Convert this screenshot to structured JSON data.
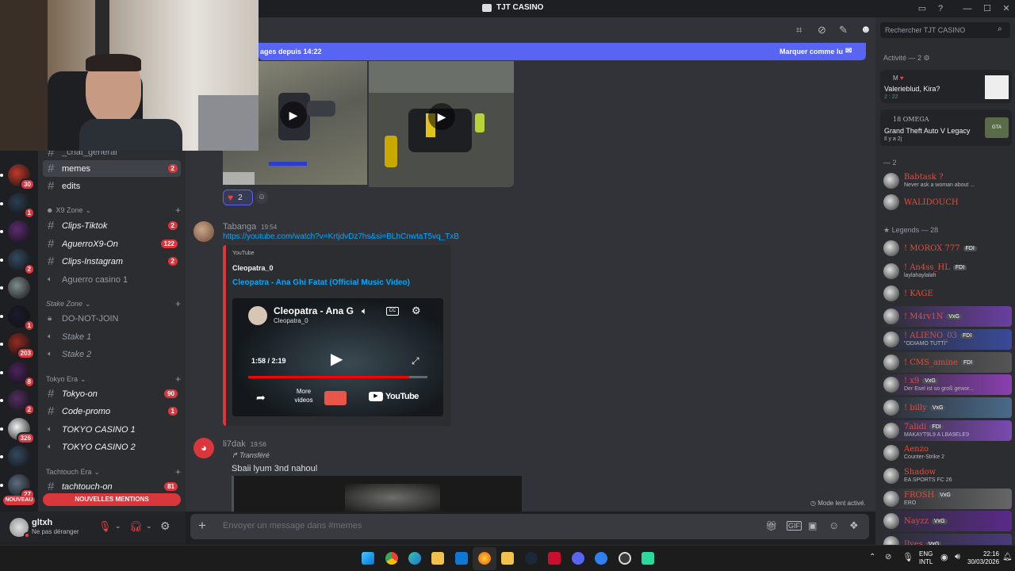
{
  "window": {
    "title": "TJT CASINO"
  },
  "search": {
    "placeholder": "Rechercher TJT CASINO"
  },
  "banner": {
    "text": "ages depuis 14:22",
    "mark_read": "Marquer comme lu"
  },
  "guilds": [
    {
      "badge": "30"
    },
    {
      "badge": "1"
    },
    {
      "badge": ""
    },
    {
      "badge": "2"
    },
    {
      "badge": ""
    },
    {
      "badge": "1"
    },
    {
      "badge": "203"
    },
    {
      "badge": "8"
    },
    {
      "badge": "2"
    },
    {
      "badge": "326"
    },
    {
      "badge": ""
    },
    {
      "badge": "27"
    }
  ],
  "guild_new_label": "NOUVEAU",
  "channels": {
    "partial_top": "_chat_general",
    "memes": {
      "name": "memes",
      "count": "2"
    },
    "edits": {
      "name": "edits"
    },
    "cat_x9": "X9 Zone",
    "clips_tiktok": {
      "name": "Clips-Tiktok",
      "count": "2"
    },
    "aguerro_on": {
      "name": "AguerroX9-On",
      "count": "122"
    },
    "clips_insta": {
      "name": "Clips-Instagram",
      "count": "2"
    },
    "aguerro_casino": {
      "name": "Aguerro casino 1"
    },
    "cat_stake": "Stake Zone",
    "do_not_join": {
      "name": "DO-NOT-JOIN"
    },
    "stake1": {
      "name": "Stake 1"
    },
    "stake2": {
      "name": "Stake 2"
    },
    "cat_tokyo": "Tokyo Era",
    "tokyo_on": {
      "name": "Tokyo-on",
      "count": "90"
    },
    "code_promo": {
      "name": "Code-promo",
      "count": "1"
    },
    "tokyo_casino1": {
      "name": "TOKYO CASINO 1"
    },
    "tokyo_casino2": {
      "name": "TOKYO CASINO 2"
    },
    "cat_tachtouch": "Tachtouch Era",
    "tachtouch_on": {
      "name": "tachtouch-on",
      "count": "81"
    },
    "new_mentions": "NOUVELLES MENTIONS"
  },
  "user": {
    "name": "gltxh",
    "status": "Ne pas déranger"
  },
  "messages": {
    "reaction_count": "2",
    "m1": {
      "author": "Tabanga",
      "time": "19:54",
      "link": "https://youtube.com/watch?v=KrtjdvDz7hs&si=BLhCnwtaT5vq_TxB",
      "provider": "YouTube",
      "channel": "Cleopatra_0",
      "title": "Cleopatra - Ana Ghi Fatat (Official Music Video)",
      "video_title": "Cleopatra - Ana G",
      "video_channel": "Cleopatra_0",
      "timecode": "1:58 / 2:19",
      "more_videos": "More videos",
      "youtube": "YouTube",
      "progress": 0.9
    },
    "m2": {
      "author": "li7dak",
      "time": "19:56",
      "forwarded": "Transféré",
      "text": "Sbaii lyum 3nd nahoul"
    }
  },
  "slowmode": "Mode lent activé.",
  "composer": {
    "placeholder": "Envoyer un message dans #memes"
  },
  "members": {
    "activity_header": "Activité — 2",
    "activity": [
      {
        "name_prefix": "M",
        "title": "Valerieblud, Kira?",
        "sub": "2 : 22"
      },
      {
        "name_prefix": "18 OMEGA",
        "title": "Grand Theft Auto V Legacy",
        "sub": "Il y a 2j"
      }
    ],
    "group2_header": "— 2",
    "group2": [
      {
        "name": "Babtask ?",
        "status": "Never ask a woman about ..."
      },
      {
        "name": "WALIDOUCH",
        "status": ""
      }
    ],
    "legends_header": "Legends — 28",
    "legends": [
      {
        "name": "! MOROX 777",
        "badge": "FDI",
        "status": ""
      },
      {
        "name": "! An4ss_HL",
        "badge": "FDI",
        "status": "laylahaylalah"
      },
      {
        "name": "! KAGE",
        "badge": "",
        "status": ""
      },
      {
        "name": "! M4rv1N",
        "badge": "VxG",
        "status": ""
      },
      {
        "name": "! ALIENO_03",
        "badge": "FDI",
        "status": "\"ODIAMO TUTTI\""
      },
      {
        "name": "! CMS_amine",
        "badge": "FDI",
        "status": ""
      },
      {
        "name": "! x9",
        "badge": "VxG",
        "status": "Der Esel ist so groß gewor..."
      },
      {
        "name": "! billy",
        "badge": "VxG",
        "status": ""
      },
      {
        "name": "7alidi",
        "badge": "FDI",
        "status": "MAKAYT9L9 A LBA9ELE9"
      },
      {
        "name": "Aenzo",
        "badge": "",
        "status": "Counter-Strike 2"
      },
      {
        "name": "Shadow",
        "badge": "",
        "status": "EA SPORTS FC 26"
      },
      {
        "name": "FROSH",
        "badge": "VxG",
        "status": "ERO"
      },
      {
        "name": "Nayzz",
        "badge": "VxG",
        "status": ""
      },
      {
        "name": "Ilyes",
        "badge": "VxG",
        "status": ""
      }
    ]
  },
  "taskbar": {
    "lang": "ENG",
    "layout": "INTL",
    "time": "22:16",
    "date": "30/03/2026"
  },
  "colors": {
    "accent": "#5865f2",
    "danger": "#da373c",
    "link": "#00a8fc",
    "member_red": "#e74c3c"
  }
}
